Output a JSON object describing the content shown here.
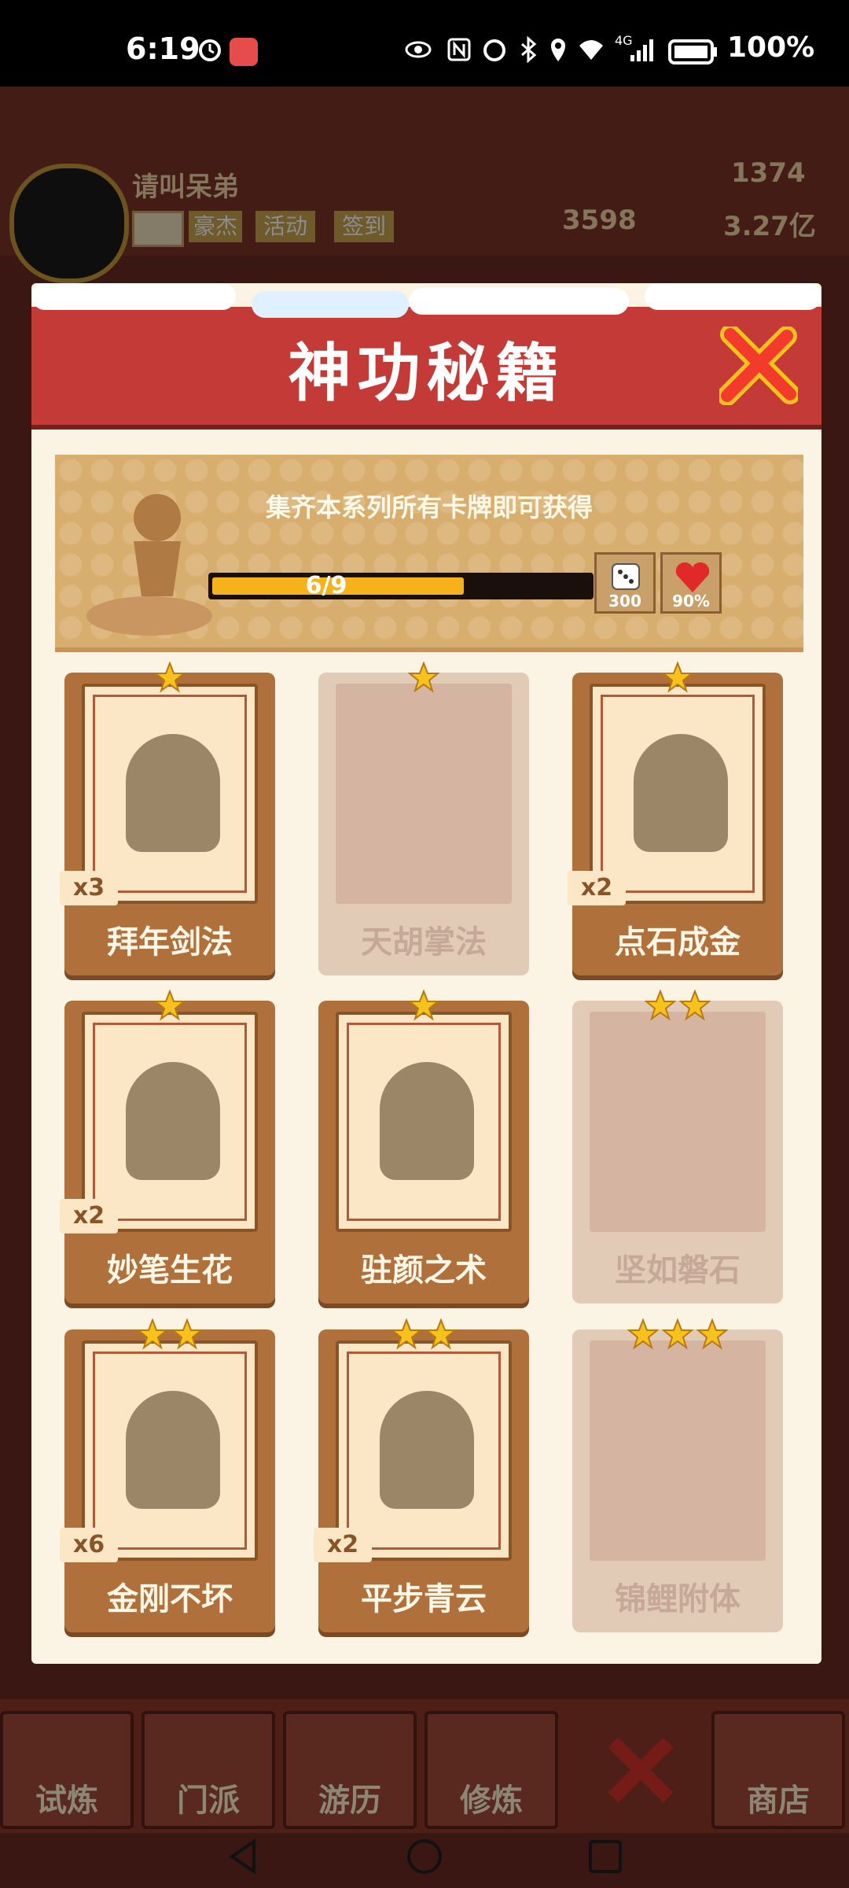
{
  "status_bar": {
    "time": "6:19",
    "battery": "100%",
    "network": "4G"
  },
  "background": {
    "player_name": "请叫呆弟",
    "rank_badge": "豪杰",
    "activity_label": "活动",
    "signin_label": "签到",
    "gems": "1374",
    "coins_a": "3598",
    "coins_b": "3.27亿",
    "nav": [
      "试炼",
      "门派",
      "游历",
      "修炼",
      "商店"
    ]
  },
  "modal": {
    "title": "神功秘籍",
    "banner_text": "集齐本系列所有卡牌即可获得",
    "progress": {
      "label": "6/9",
      "collected": 6,
      "total": 9
    },
    "rewards": [
      {
        "icon": "dice-icon",
        "value": "300"
      },
      {
        "icon": "heart-icon",
        "value": "90%"
      }
    ],
    "cards": [
      {
        "name": "拜年剑法",
        "stars": 1,
        "count": "x3",
        "owned": true,
        "icon": "sword-icon"
      },
      {
        "name": "天胡掌法",
        "stars": 1,
        "count": "",
        "owned": false,
        "icon": ""
      },
      {
        "name": "点石成金",
        "stars": 1,
        "count": "x2",
        "owned": true,
        "icon": "gold-finger-icon"
      },
      {
        "name": "妙笔生花",
        "stars": 1,
        "count": "x2",
        "owned": true,
        "icon": "flower-hand-icon"
      },
      {
        "name": "驻颜之术",
        "stars": 1,
        "count": "",
        "owned": true,
        "icon": "mask-icon"
      },
      {
        "name": "坚如磐石",
        "stars": 2,
        "count": "",
        "owned": false,
        "icon": ""
      },
      {
        "name": "金刚不坏",
        "stars": 2,
        "count": "x6",
        "owned": true,
        "icon": "muscle-icon"
      },
      {
        "name": "平步青云",
        "stars": 2,
        "count": "x2",
        "owned": true,
        "icon": "cloud-rider-icon"
      },
      {
        "name": "锦鲤附体",
        "stars": 3,
        "count": "",
        "owned": false,
        "icon": ""
      }
    ]
  },
  "colors": {
    "modal_header": "#c33a36",
    "progress_fill": "#f5b21a",
    "star": "#f7c21e",
    "close": "#f23b2d"
  }
}
